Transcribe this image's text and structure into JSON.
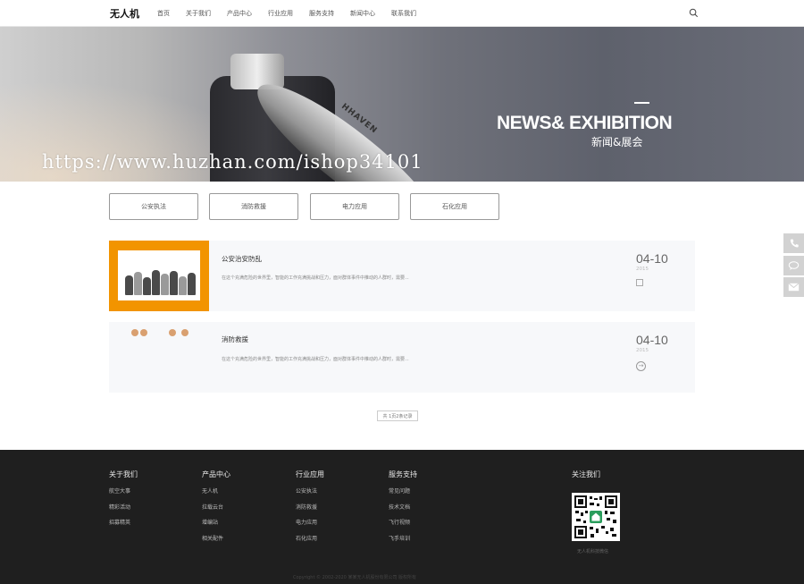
{
  "header": {
    "logo": "无人机",
    "nav": [
      "首页",
      "关于我们",
      "产品中心",
      "行业应用",
      "服务支持",
      "新闻中心",
      "联系我们"
    ]
  },
  "banner": {
    "title": "NEWS& EXHIBITION",
    "subtitle": "新闻&展会",
    "watermark": "https://www.huzhan.com/ishop34101",
    "prop_text": "HHAVEN"
  },
  "categories": [
    "公安执法",
    "消防救援",
    "电力应用",
    "石化应用"
  ],
  "news": [
    {
      "title": "公安治安防乱",
      "desc": "在这个充满危险的世界里，智能的工作充满挑战和压力，面对群体事件中推动的人群时，需要...",
      "date": "04-10",
      "year": "2015"
    },
    {
      "title": "消防救援",
      "desc": "在这个充满危险的世界里，智能的工作充满挑战和压力，面对群体事件中推动的人群时，需要...",
      "date": "04-10",
      "year": "2015"
    }
  ],
  "pagination": "共 1页2条记录",
  "footer": {
    "columns": [
      {
        "head": "关于我们",
        "links": [
          "航空大事",
          "精彩活动",
          "招募精英"
        ]
      },
      {
        "head": "产品中心",
        "links": [
          "无人机",
          "拉载云台",
          "增编站",
          "相关配件"
        ]
      },
      {
        "head": "行业应用",
        "links": [
          "公安执法",
          "消防救援",
          "电力应用",
          "石化应用"
        ]
      },
      {
        "head": "服务支持",
        "links": [
          "常见问题",
          "技术文档",
          "飞行视频",
          "飞手培训"
        ]
      }
    ],
    "follow_head": "关注我们",
    "qr_caption": "无人机科技微信",
    "copyright": "Copyright © 2002-2020 某某无人机股份有限公司 版权所有"
  },
  "colors": {
    "accent_orange": "#f29400",
    "footer_bg": "#1f1f1f"
  },
  "icons": [
    "search-icon",
    "phone-icon",
    "chat-icon",
    "mail-icon",
    "arrow-right-icon"
  ]
}
